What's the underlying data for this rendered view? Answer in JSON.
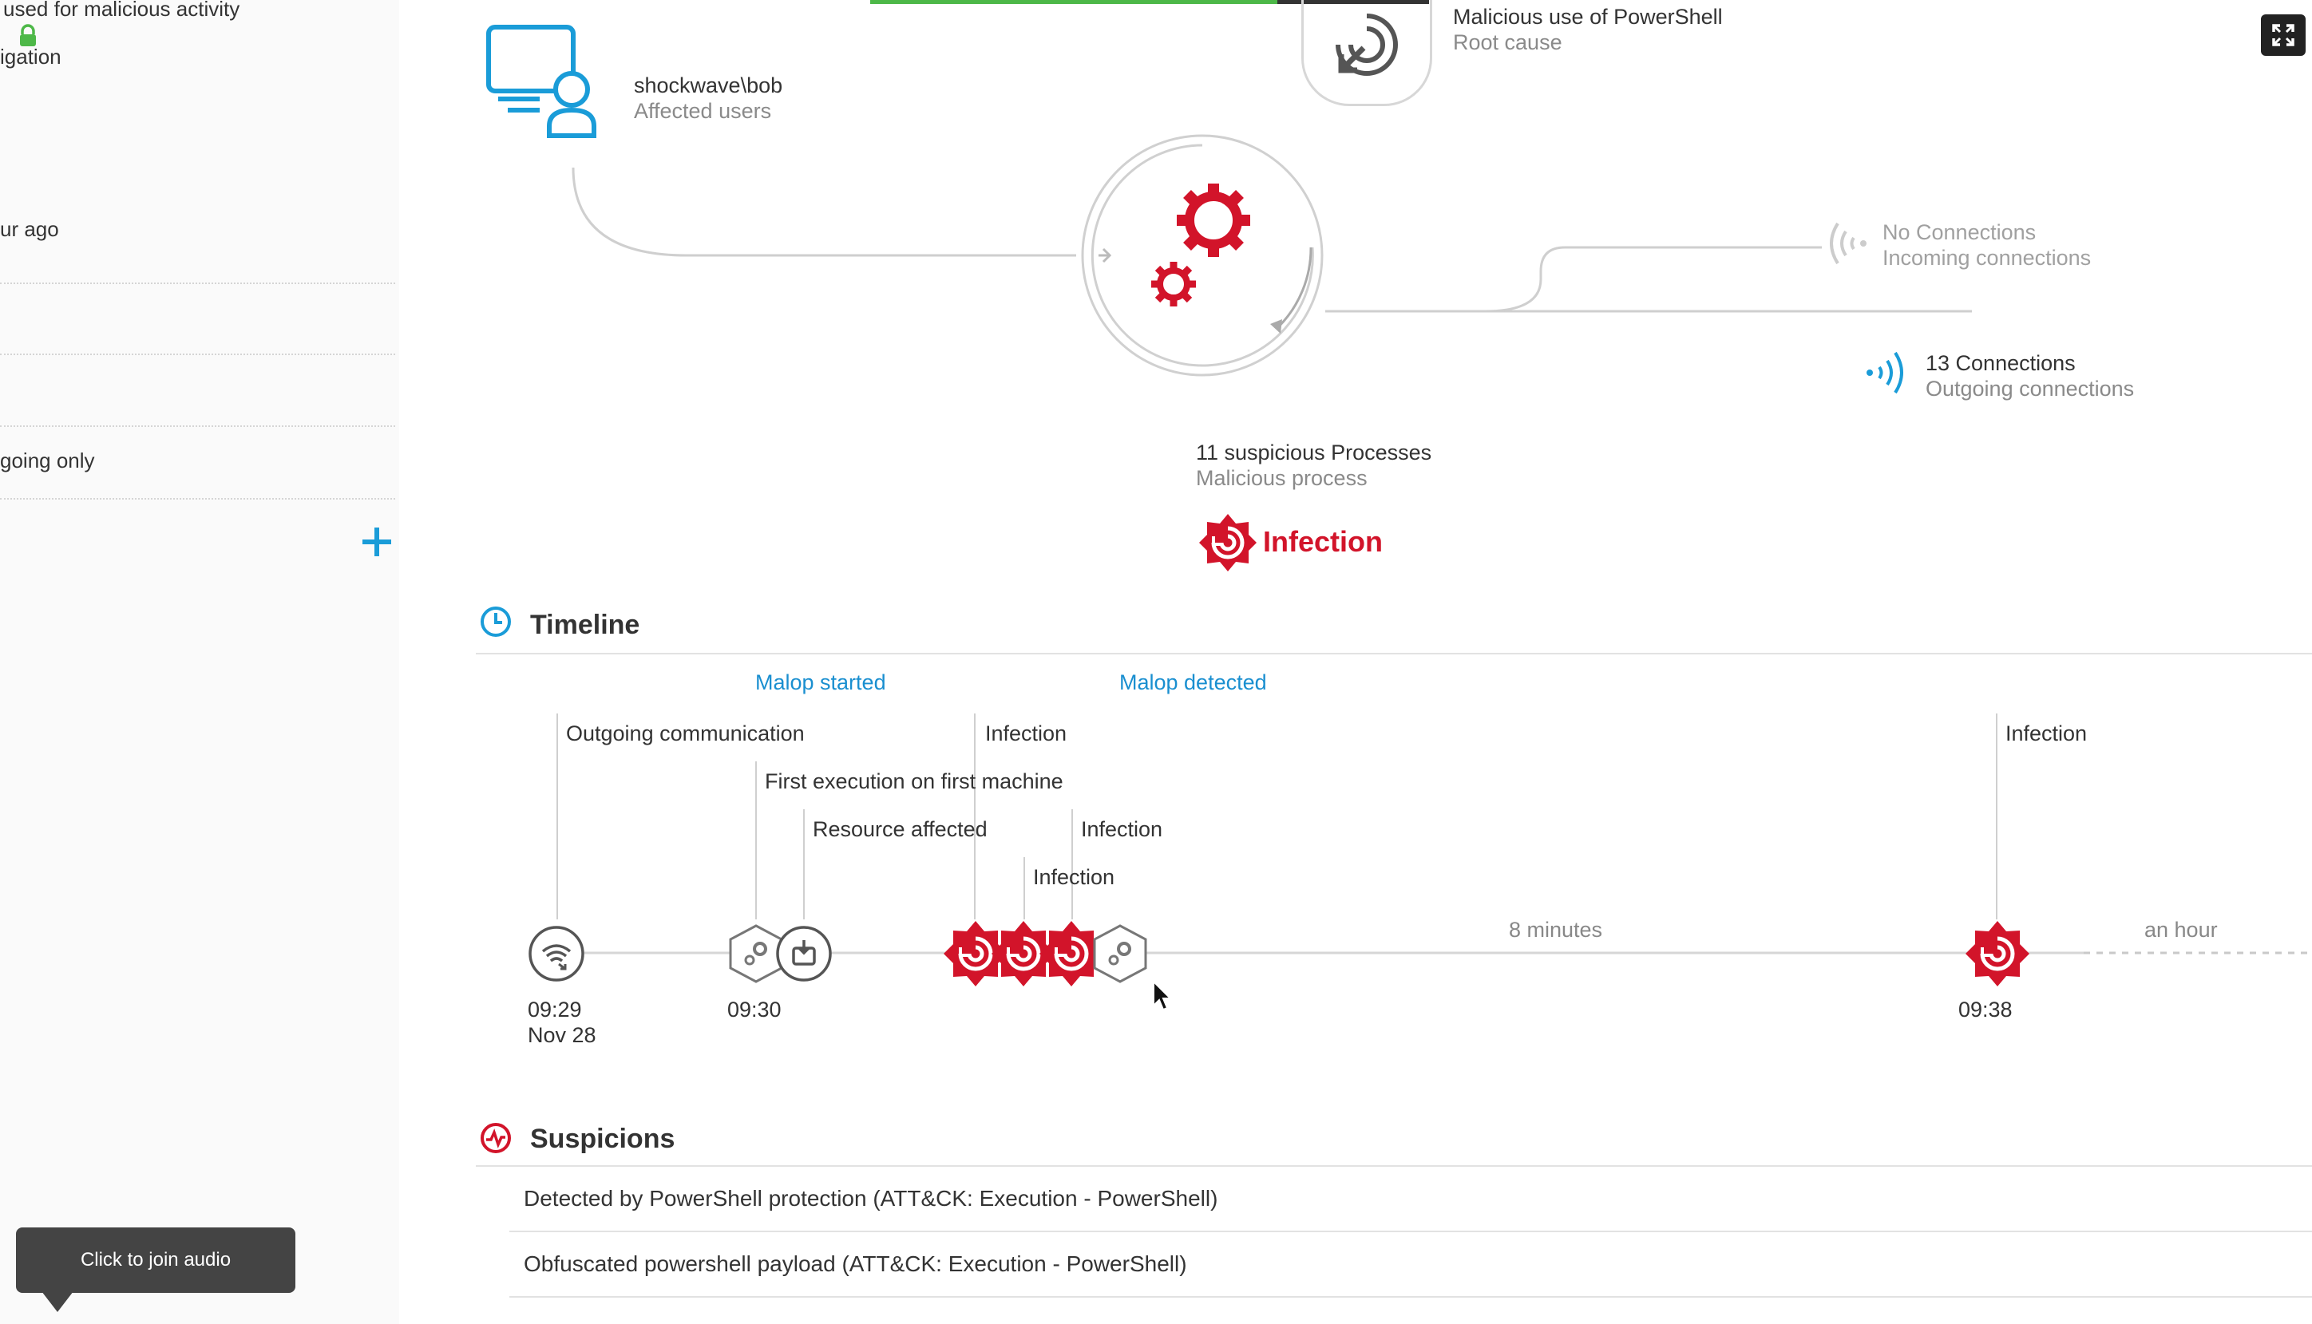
{
  "sidebar": {
    "line1": "used for malicious activity",
    "line2": "igation",
    "line3": "ur ago",
    "line4": "going only"
  },
  "graph": {
    "affected_user": {
      "name": "shockwave\\bob",
      "label": "Affected users"
    },
    "root_cause": {
      "name": "Malicious use of PowerShell",
      "label": "Root cause"
    },
    "incoming": {
      "name": "No Connections",
      "label": "Incoming connections"
    },
    "outgoing": {
      "name": "13 Connections",
      "label": "Outgoing connections"
    },
    "processes": {
      "name": "11 suspicious Processes",
      "label": "Malicious process"
    },
    "infection_badge": "Infection"
  },
  "timeline": {
    "title": "Timeline",
    "markers": {
      "malop_started": "Malop started",
      "malop_detected": "Malop detected"
    },
    "events": {
      "outgoing_communication": "Outgoing communication",
      "first_execution": "First execution on first machine",
      "resource_affected": "Resource affected",
      "infection_1": "Infection",
      "infection_2": "Infection",
      "infection_3": "Infection",
      "infection_4": "Infection"
    },
    "gaps": {
      "gap1": "8 minutes",
      "gap2": "an hour"
    },
    "times": {
      "t1_time": "09:29",
      "t1_date": "Nov 28",
      "t2_time": "09:30",
      "t3_time": "09:38"
    }
  },
  "suspicions": {
    "title": "Suspicions",
    "items": [
      "Detected by PowerShell protection (ATT&CK: Execution - PowerShell)",
      "Obfuscated powershell payload (ATT&CK: Execution - PowerShell)"
    ]
  },
  "tooltip": {
    "label": "Click to join audio"
  },
  "colors": {
    "accent_blue": "#1a9cd8",
    "infection_red": "#d2142a",
    "progress_green": "#4db848"
  },
  "icons": [
    "lock-icon",
    "plus-icon",
    "computer-user-icon",
    "powershell-icon",
    "gears-icon",
    "incoming-signal-icon",
    "outgoing-signal-icon",
    "infection-icon",
    "clock-icon",
    "suspicions-icon",
    "wifi-icon",
    "process-gear-icon",
    "resource-icon",
    "expand-icon",
    "mouse-cursor-icon"
  ]
}
